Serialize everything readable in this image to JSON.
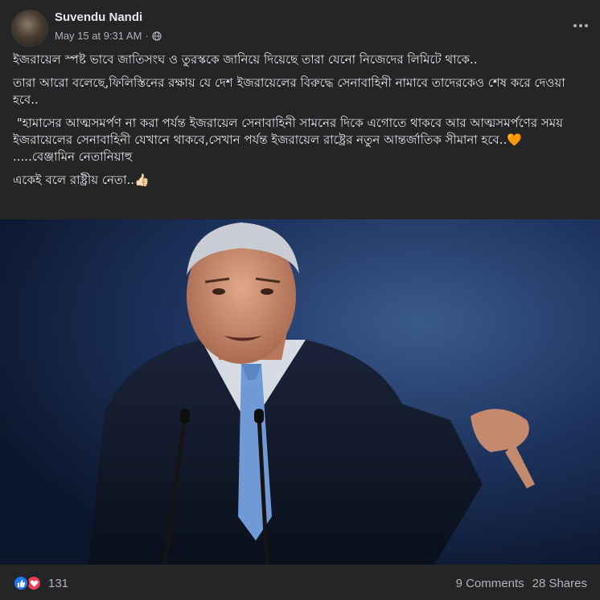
{
  "post": {
    "author": "Suvendu Nandi",
    "timestamp": "May 15 at 9:31 AM",
    "separator": "·",
    "audience_icon": "globe-icon",
    "more_icon": "more-options-icon",
    "paragraphs": [
      "ইজরায়েল স্পষ্ট ভাবে জাতিসংঘ ও তুরস্ককে জানিয়ে দিয়েছে তারা যেনো নিজেদের লিমিটে থাকে..",
      "তারা আরো বলেছে,ফিলিস্তিনের রক্ষায় যে দেশ ইজরায়েলের বিরুদ্ধে সেনাবাহিনী নামাবে তাদেরকেও শেষ করে দেওয়া হবে..",
      " \"হামাসের আত্মসমর্পণ না করা পর্যন্ত ইজরায়েল সেনাবাহিনী সামনের দিকে এগোতে থাকবে আর আত্মসমর্পণের সময় ইজরায়েলের সেনাবাহিনী যেখানে থাকবে,সেখান পর্যন্ত ইজরায়েল রাষ্ট্রের নতুন আন্তর্জাতিক সীমানা হবে..🧡",
      ".....বেঞ্জামিন নেতানিয়াহু",
      "একেই বলে রাষ্ট্রীয় নেতা..👍🏻"
    ]
  },
  "footer": {
    "reaction_icons": [
      "like-icon",
      "love-icon"
    ],
    "reaction_count": "131",
    "comments": "9 Comments",
    "shares": "28 Shares"
  },
  "colors": {
    "background": "#242526",
    "text_primary": "#e4e6eb",
    "text_secondary": "#b0b3b8",
    "like_blue": "#2078f4",
    "love_red": "#f33e58"
  }
}
